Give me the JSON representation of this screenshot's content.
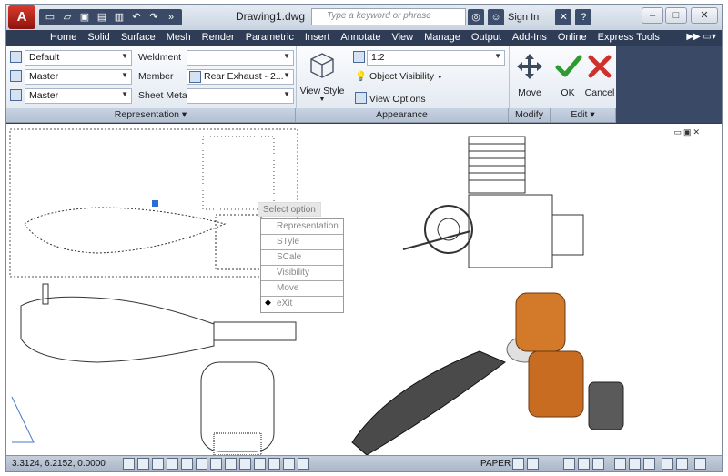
{
  "app": {
    "logo": "A",
    "document_title": "Drawing1.dwg"
  },
  "search": {
    "placeholder": "Type a keyword or phrase"
  },
  "title_icons": {
    "sign_in": "Sign In",
    "help": "?",
    "minimize": "–",
    "maximize": "□",
    "close": "✕"
  },
  "tabs": [
    "Home",
    "Solid",
    "Surface",
    "Mesh",
    "Render",
    "Parametric",
    "Insert",
    "Annotate",
    "View",
    "Manage",
    "Output",
    "Add-Ins",
    "Online",
    "Express Tools"
  ],
  "representation": {
    "combo_default": "Default",
    "combo_master1": "Master",
    "combo_master2": "Master",
    "weldment_label": "Weldment",
    "member_label": "Member",
    "member_value": "Rear Exhaust - 2...",
    "sheetmetal_label": "Sheet Metal",
    "panel_label": "Representation"
  },
  "appearance": {
    "view_style_label": "View Style",
    "scale_value": "1:2",
    "object_visibility_label": "Object Visibility",
    "view_options_label": "View Options",
    "panel_label": "Appearance"
  },
  "modify": {
    "move_label": "Move",
    "panel_label": "Modify"
  },
  "edit": {
    "ok_label": "OK",
    "cancel_label": "Cancel",
    "panel_label": "Edit"
  },
  "context_menu": {
    "title": "Select option",
    "items": [
      "Representation",
      "STyle",
      "SCale",
      "Visibility",
      "Move",
      "eXit"
    ]
  },
  "status_bar": {
    "coordinates": "3.3124, 6.2152, 0.0000",
    "paper_label": "PAPER"
  },
  "colors": {
    "accent": "#2e3d55",
    "ok": "#2e9b2e",
    "cancel": "#d0302a",
    "engine_orange": "#d37a2a"
  }
}
